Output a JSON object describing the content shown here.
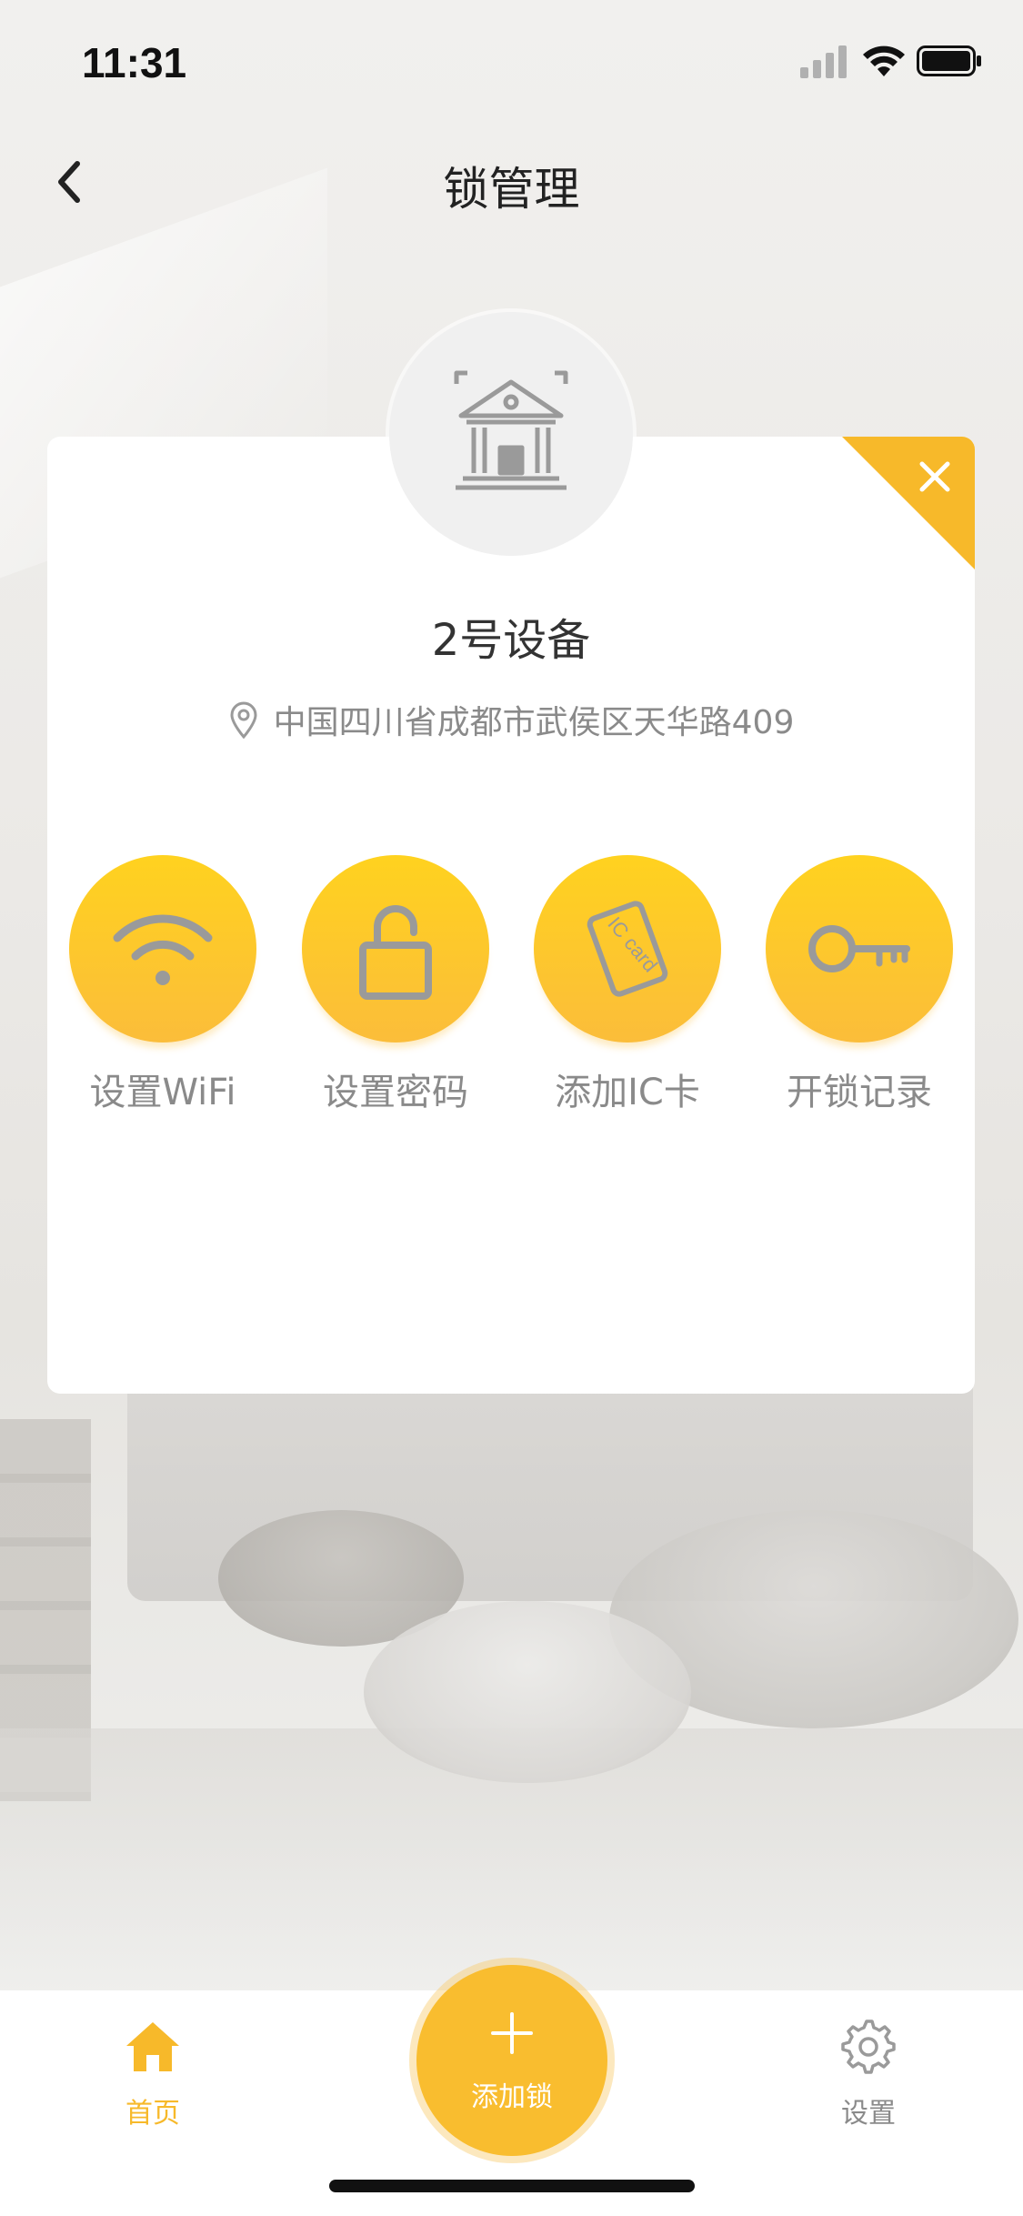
{
  "status_bar": {
    "time": "11:31"
  },
  "nav": {
    "title": "锁管理",
    "back_icon": "chevron-left-icon"
  },
  "card": {
    "close_icon": "close-icon",
    "avatar_icon": "building-icon",
    "device_name": "2号设备",
    "location_icon": "location-pin-icon",
    "address": "中国四川省成都市武侯区天华路409",
    "actions": [
      {
        "label": "设置WiFi",
        "icon": "wifi-icon"
      },
      {
        "label": "设置密码",
        "icon": "unlock-icon"
      },
      {
        "label": "添加IC卡",
        "icon": "ic-card-icon",
        "icon_text": "IC card"
      },
      {
        "label": "开锁记录",
        "icon": "key-icon"
      }
    ]
  },
  "tab_bar": {
    "home_label": "首页",
    "add_label": "添加锁",
    "settings_label": "设置"
  },
  "colors": {
    "accent": "#f7b92a",
    "action_gradient_top": "#ffd21f",
    "action_gradient_bottom": "#fbbd3a",
    "text_muted": "#8a8a8a"
  }
}
